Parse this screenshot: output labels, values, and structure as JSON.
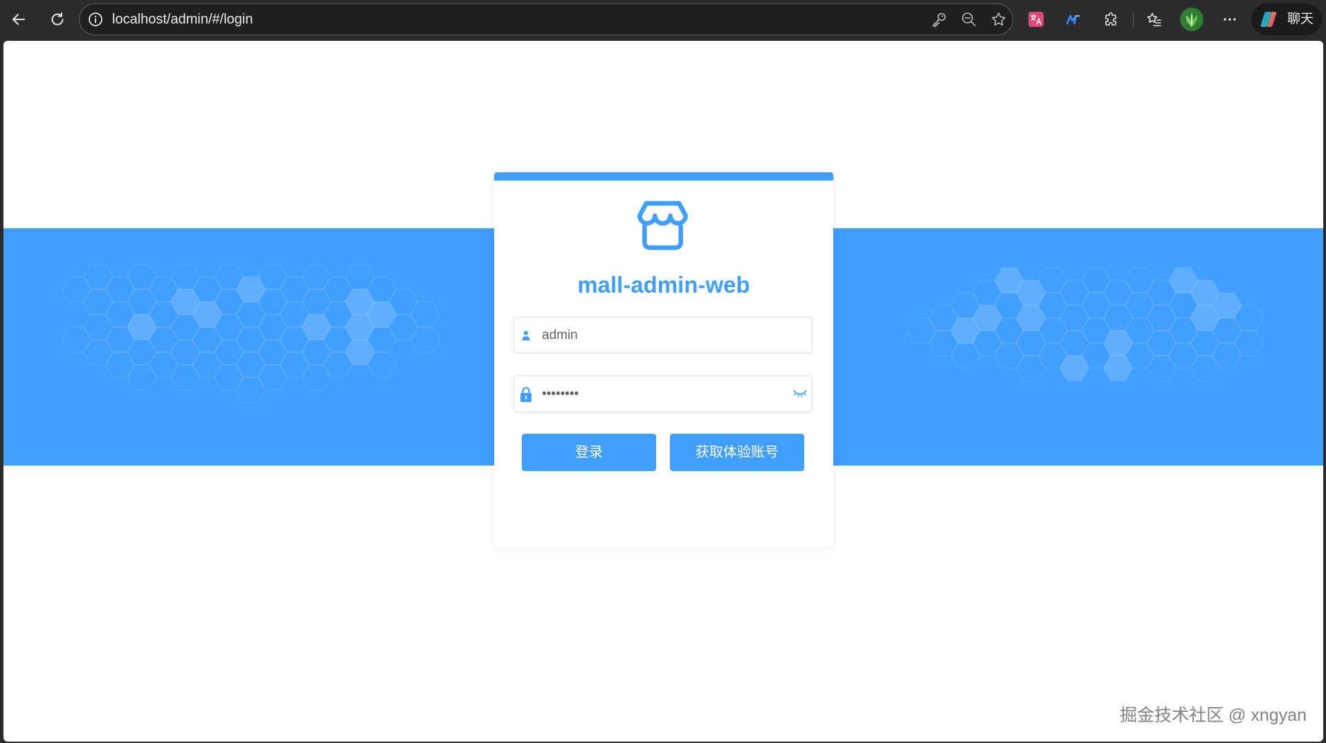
{
  "browser": {
    "address_bar": {
      "url": "localhost/admin/#/login"
    },
    "copilot": {
      "label": "聊天"
    },
    "icons": [
      "back-arrow-icon",
      "refresh-icon",
      "site-info-icon",
      "key-icon",
      "zoom-out-icon",
      "favorite-star-icon",
      "translate-extension-icon",
      "m-extension-icon",
      "extensions-puzzle-icon",
      "favorites-list-icon",
      "profile-avatar-icon",
      "more-ellipsis-icon",
      "copilot-icon"
    ]
  },
  "login": {
    "logo_icon": "shop-icon",
    "title": "mall-admin-web",
    "username": {
      "icon": "user-icon",
      "value": "admin"
    },
    "password": {
      "icon": "lock-icon",
      "masked_value": "••••••••",
      "toggle_icon": "eye-closed-icon"
    },
    "buttons": {
      "login": "登录",
      "get_trial_account": "获取体验账号"
    }
  },
  "watermark": "掘金技术社区 @ xngyan",
  "colors": {
    "accent": "#409EFF",
    "browser_chrome": "#2b2b2b",
    "page_background": "#FFFFFF",
    "input_border": "#DCDFE6",
    "input_text": "#606266"
  }
}
